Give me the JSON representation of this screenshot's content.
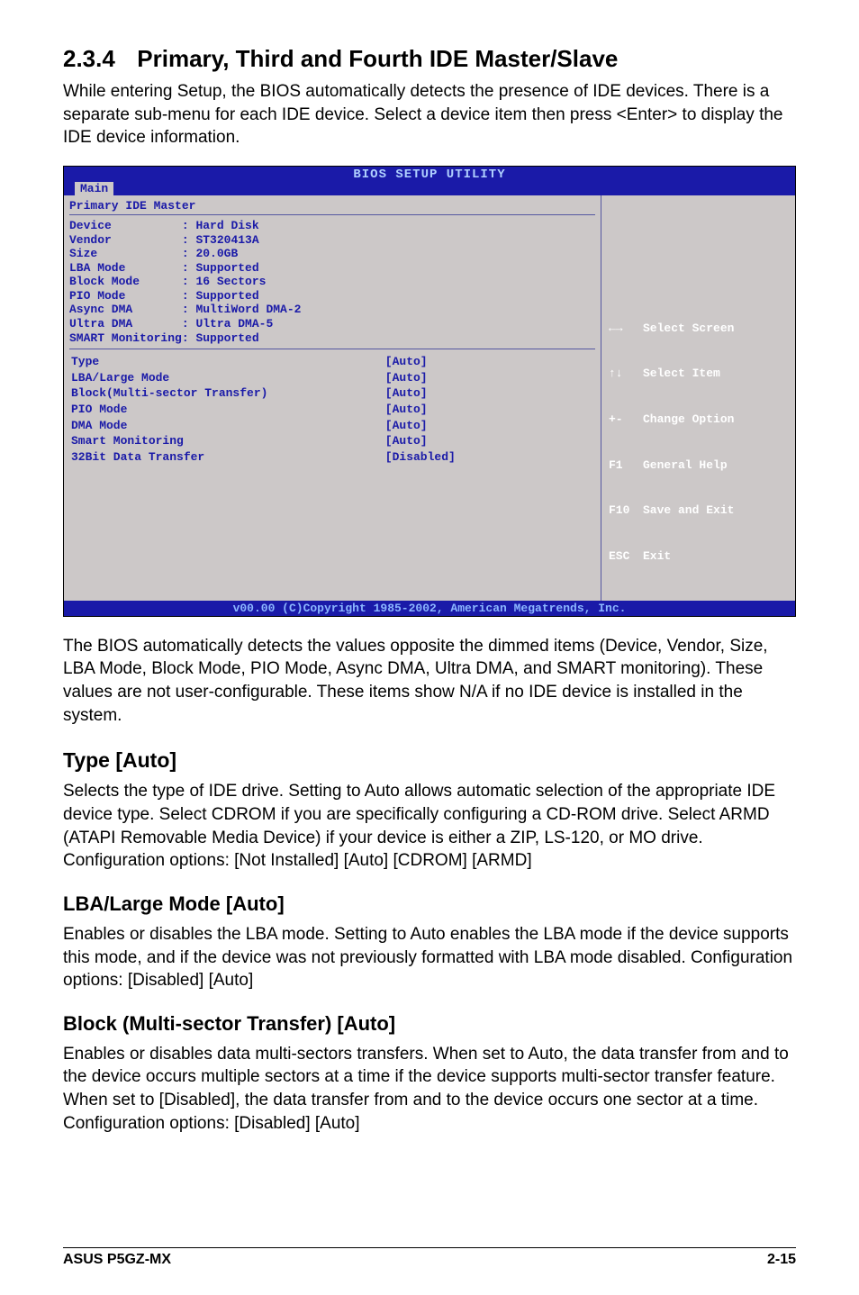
{
  "header": {
    "num": "2.3.4",
    "title": "Primary, Third and Fourth IDE Master/Slave"
  },
  "intro": "While entering Setup, the BIOS automatically detects the presence of IDE devices. There is a separate sub-menu for each IDE device. Select a device item then press <Enter> to display the IDE device information.",
  "bios": {
    "title": "BIOS SETUP UTILITY",
    "tab": "Main",
    "panel_title": "Primary IDE Master",
    "info": [
      {
        "label": "Device",
        "value": "Hard Disk"
      },
      {
        "label": "Vendor",
        "value": "ST320413A"
      },
      {
        "label": "Size",
        "value": "20.0GB"
      },
      {
        "label": "LBA Mode",
        "value": "Supported"
      },
      {
        "label": "Block Mode",
        "value": "16 Sectors"
      },
      {
        "label": "PIO Mode",
        "value": "Supported"
      },
      {
        "label": "Async DMA",
        "value": "MultiWord DMA-2"
      },
      {
        "label": "Ultra DMA",
        "value": "Ultra DMA-5"
      },
      {
        "label": "SMART Monitoring",
        "value": "Supported"
      }
    ],
    "settings": [
      {
        "label": "Type",
        "value": "[Auto]"
      },
      {
        "label": "LBA/Large Mode",
        "value": "[Auto]"
      },
      {
        "label": "Block(Multi-sector Transfer)",
        "value": "[Auto]"
      },
      {
        "label": "PIO Mode",
        "value": "[Auto]"
      },
      {
        "label": "DMA Mode",
        "value": "[Auto]"
      },
      {
        "label": "Smart Monitoring",
        "value": "[Auto]"
      },
      {
        "label": "32Bit Data Transfer",
        "value": "[Disabled]"
      }
    ],
    "help": [
      {
        "key": "←→",
        "text": "Select Screen"
      },
      {
        "key": "↑↓",
        "text": "Select Item"
      },
      {
        "key": "+-",
        "text": "Change Option"
      },
      {
        "key": "F1",
        "text": "General Help"
      },
      {
        "key": "F10",
        "text": "Save and Exit"
      },
      {
        "key": "ESC",
        "text": "Exit"
      }
    ],
    "footer": "v00.00 (C)Copyright 1985-2002, American Megatrends, Inc."
  },
  "after_bios": "The BIOS automatically detects the values opposite the dimmed items (Device, Vendor, Size, LBA Mode, Block Mode, PIO Mode, Async DMA, Ultra DMA, and SMART monitoring). These values are not user-configurable. These items show N/A if no IDE device is installed in the system.",
  "sections": [
    {
      "heading": "Type [Auto]",
      "body": "Selects the type of IDE drive. Setting to Auto allows automatic selection of the appropriate IDE device type. Select CDROM if you are specifically configuring a CD-ROM drive. Select ARMD (ATAPI Removable Media Device) if your device is either a ZIP, LS-120, or MO drive. Configuration options: [Not Installed] [Auto] [CDROM] [ARMD]"
    },
    {
      "heading": "LBA/Large Mode [Auto]",
      "body": "Enables or disables the LBA mode. Setting to Auto enables the LBA mode if the device supports this mode, and if the device was not previously formatted with LBA mode disabled. Configuration options: [Disabled] [Auto]"
    },
    {
      "heading": "Block (Multi-sector Transfer) [Auto]",
      "body": "Enables or disables data multi-sectors transfers. When set to Auto, the data transfer from and to the device occurs multiple sectors at a time if the device supports multi-sector transfer feature. When set to [Disabled], the data transfer from and to the device occurs one sector at a time. Configuration options: [Disabled] [Auto]"
    }
  ],
  "footer": {
    "left": "ASUS P5GZ-MX",
    "right": "2-15"
  }
}
